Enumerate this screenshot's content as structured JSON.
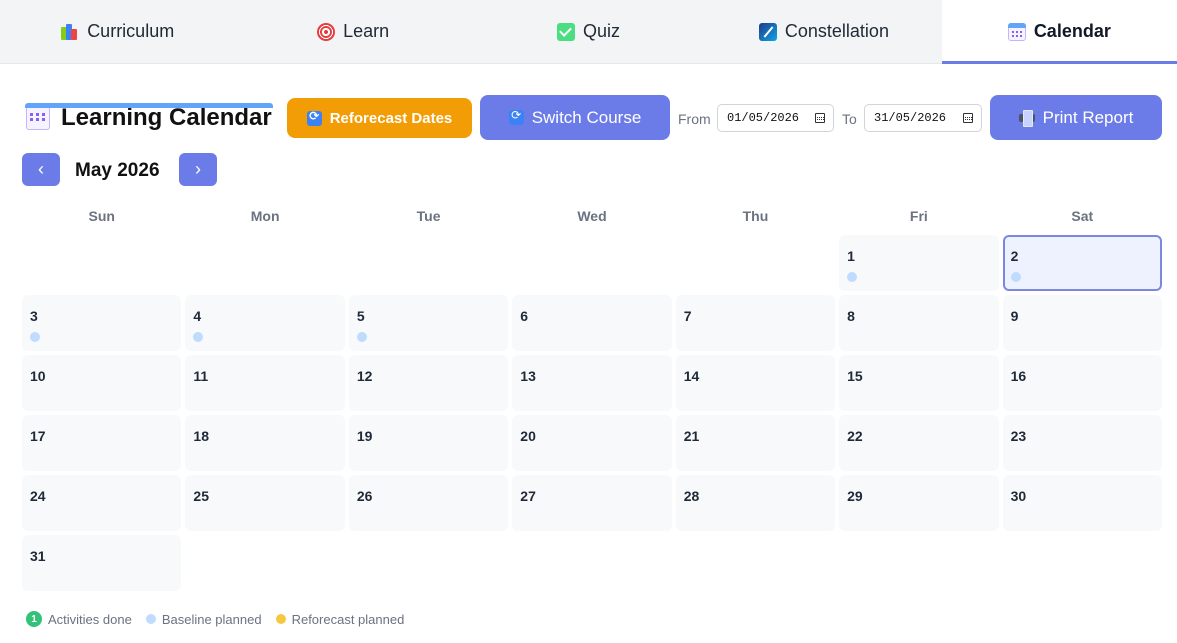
{
  "tabs": [
    {
      "label": "Curriculum",
      "icon": "books-icon",
      "active": false
    },
    {
      "label": "Learn",
      "icon": "target-icon",
      "active": false
    },
    {
      "label": "Quiz",
      "icon": "check-box-icon",
      "active": false
    },
    {
      "label": "Constellation",
      "icon": "constellation-icon",
      "active": false
    },
    {
      "label": "Calendar",
      "icon": "calendar-icon",
      "active": true
    }
  ],
  "header": {
    "title": "Learning Calendar",
    "title_icon": "calendar-icon"
  },
  "toolbar": {
    "reforecast_label": "Reforecast Dates",
    "switch_course_label": "Switch Course",
    "from_label": "From",
    "from_value": "01/05/2026",
    "to_label": "To",
    "to_value": "31/05/2026",
    "print_label": "Print Report"
  },
  "month_nav": {
    "prev_label": "‹",
    "next_label": "›",
    "month_label": "May 2026"
  },
  "calendar": {
    "weekdays": [
      "Sun",
      "Mon",
      "Tue",
      "Wed",
      "Thu",
      "Fri",
      "Sat"
    ],
    "leading_blanks": 5,
    "days": [
      {
        "day": "1",
        "baseline": true
      },
      {
        "day": "2",
        "baseline": true,
        "today": true
      },
      {
        "day": "3",
        "baseline": true
      },
      {
        "day": "4",
        "baseline": true
      },
      {
        "day": "5",
        "baseline": true
      },
      {
        "day": "6"
      },
      {
        "day": "7"
      },
      {
        "day": "8"
      },
      {
        "day": "9"
      },
      {
        "day": "10"
      },
      {
        "day": "11"
      },
      {
        "day": "12"
      },
      {
        "day": "13"
      },
      {
        "day": "14"
      },
      {
        "day": "15"
      },
      {
        "day": "16"
      },
      {
        "day": "17"
      },
      {
        "day": "18"
      },
      {
        "day": "19"
      },
      {
        "day": "20"
      },
      {
        "day": "21"
      },
      {
        "day": "22"
      },
      {
        "day": "23"
      },
      {
        "day": "24"
      },
      {
        "day": "25"
      },
      {
        "day": "26"
      },
      {
        "day": "27"
      },
      {
        "day": "28"
      },
      {
        "day": "29"
      },
      {
        "day": "30"
      },
      {
        "day": "31"
      }
    ]
  },
  "legend": {
    "done_badge": "1",
    "done_label": "Activities done",
    "baseline_label": "Baseline planned",
    "reforecast_label": "Reforecast planned"
  },
  "colors": {
    "accent": "#6b7ce8",
    "reforecast": "#f29d05",
    "done": "#34c17a",
    "baseline_dot": "#bfdbfe",
    "reforecast_dot": "#f5c842"
  }
}
